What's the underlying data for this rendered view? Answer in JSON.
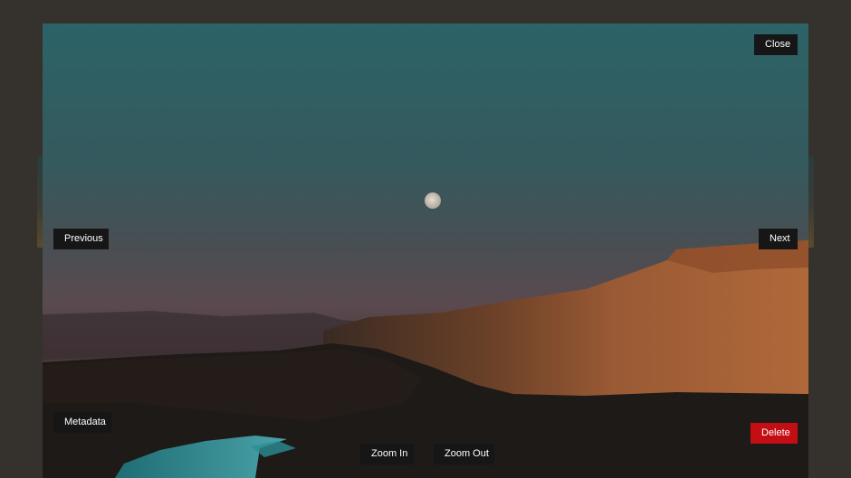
{
  "viewer": {
    "photo_description_icon": "moon-landscape-photo",
    "buttons": {
      "close": "Close",
      "previous": "Previous",
      "next": "Next",
      "metadata": "Metadata",
      "delete": "Delete",
      "zoom_in": "Zoom In",
      "zoom_out": "Zoom Out"
    }
  },
  "colors": {
    "backdrop": "#35312c",
    "button_bg": "#161616",
    "button_text": "#ffffff",
    "delete_bg": "#c30e14"
  }
}
